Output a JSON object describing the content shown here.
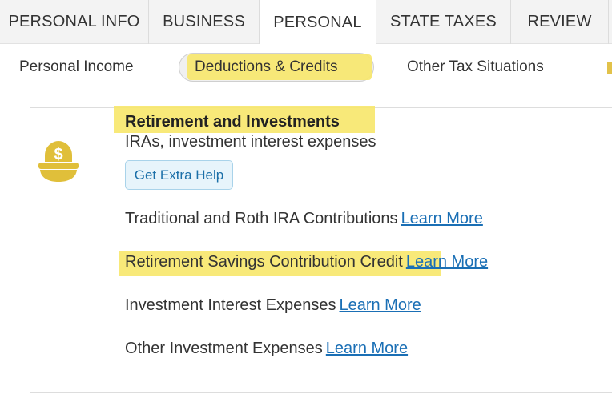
{
  "top_tabs": [
    {
      "label": "PERSONAL INFO"
    },
    {
      "label": "BUSINESS"
    },
    {
      "label": "PERSONAL"
    },
    {
      "label": "STATE TAXES"
    },
    {
      "label": "REVIEW"
    }
  ],
  "top_tabs_active": "PERSONAL",
  "sub_tabs": [
    {
      "label": "Personal Income"
    },
    {
      "label": "Deductions & Credits"
    },
    {
      "label": "Other Tax Situations"
    }
  ],
  "sub_tabs_active": "Deductions & Credits",
  "section": {
    "title": "Retirement and Investments",
    "subtitle": "IRAs, investment interest expenses",
    "help_button": "Get Extra Help",
    "icon": "piggy-bank-dollar-icon"
  },
  "items": [
    {
      "label": "Traditional and Roth IRA Contributions",
      "link": "Learn More"
    },
    {
      "label": "Retirement Savings Contribution Credit",
      "link": "Learn More"
    },
    {
      "label": "Investment Interest Expenses",
      "link": "Learn More"
    },
    {
      "label": "Other Investment Expenses",
      "link": "Learn More"
    }
  ],
  "colors": {
    "highlight": "#f7e76a",
    "link": "#1a6fb5",
    "icon_gold": "#e0bf3a"
  }
}
